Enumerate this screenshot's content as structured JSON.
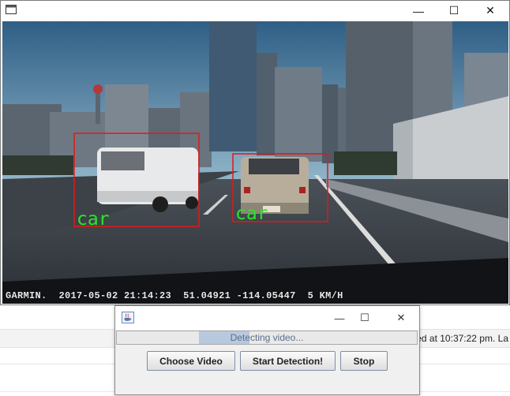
{
  "background": {
    "status_text": "ved at 10:37:22 pm. La"
  },
  "video_window": {
    "icons": {
      "app": "java-app-icon",
      "minimize": "minimize-icon",
      "maximize": "maximize-icon",
      "close": "close-icon"
    },
    "window_controls": {
      "minimize": "—",
      "maximize": "☐",
      "close": "✕"
    },
    "overlay": {
      "brand": "GARMIN.",
      "datetime": "2017-05-02 21:14:23",
      "coords": "51.04921 -114.05447",
      "speed": "5 KM/H"
    },
    "detections": [
      {
        "label": "car",
        "color": "#e01919"
      },
      {
        "label": "car",
        "color": "#e01919"
      }
    ]
  },
  "detector_dialog": {
    "icons": {
      "app": "java-cup-icon",
      "minimize": "minimize-icon",
      "maximize": "maximize-icon",
      "close": "close-icon"
    },
    "window_controls": {
      "minimize": "—",
      "maximize": "☐",
      "close": "✕"
    },
    "progress_text": "Detecting video...",
    "buttons": {
      "choose_video": "Choose Video",
      "start_detection": "Start Detection!",
      "stop": "Stop"
    }
  }
}
